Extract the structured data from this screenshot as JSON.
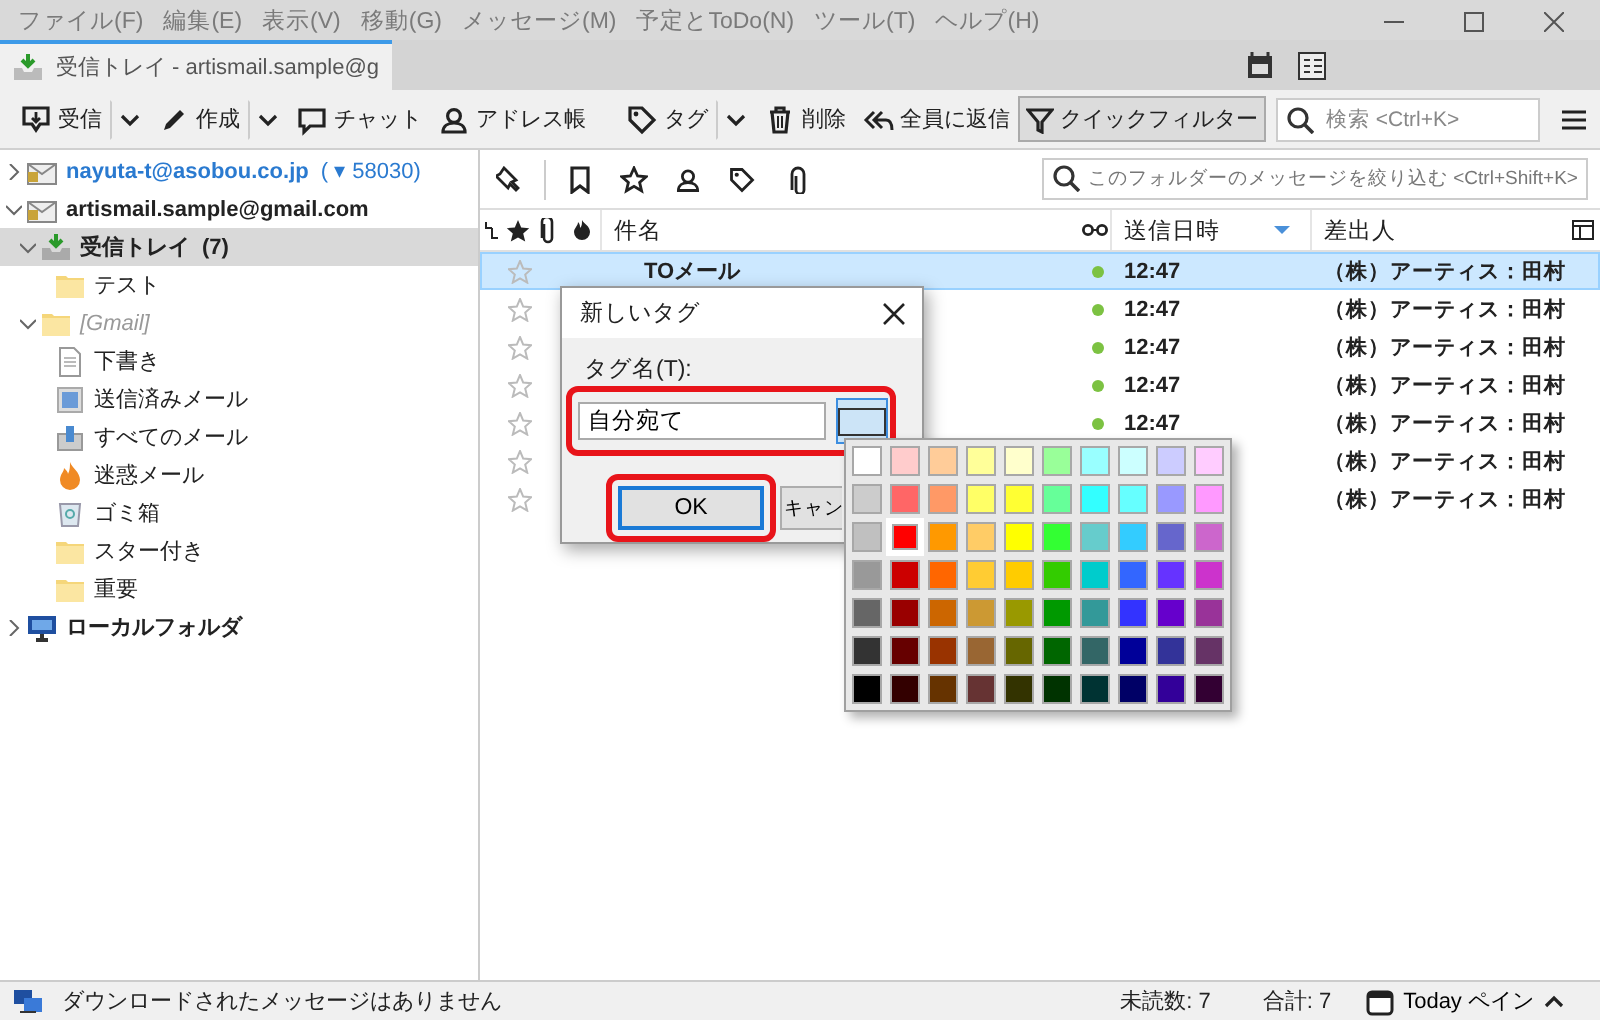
{
  "menu_bar": {
    "items": [
      "ファイル(F)",
      "編集(E)",
      "表示(V)",
      "移動(G)",
      "メッセージ(M)",
      "予定とToDo(N)",
      "ツール(T)",
      "ヘルプ(H)"
    ]
  },
  "tabs": [
    {
      "label": "受信トレイ - artismail.sample@g",
      "selected": true
    }
  ],
  "toolbar": {
    "left": [
      {
        "label": "受信",
        "kind": "get",
        "dropdown": true
      },
      {
        "label": "作成",
        "kind": "write",
        "dropdown": true
      },
      {
        "label": "チャット",
        "kind": "chat",
        "dropdown": false
      },
      {
        "label": "アドレス帳",
        "kind": "contacts",
        "dropdown": false
      },
      {
        "label": "タグ",
        "kind": "tag",
        "dropdown": true
      },
      {
        "label": "削除",
        "kind": "delete",
        "dropdown": false
      }
    ],
    "reply_all": {
      "label": "全員に返信"
    },
    "quick_filter": {
      "label": "クイックフィルター",
      "on": true
    },
    "search": {
      "placeholder": "検索 <Ctrl+K>"
    }
  },
  "folders": [
    {
      "label": "nayuta-t@asobou.co.jp",
      "count": "( ▾ 58030)",
      "kind": "account",
      "expanded": false,
      "selected": false
    },
    {
      "label": "artismail.sample@gmail.com",
      "kind": "account",
      "expanded": true,
      "selected": false,
      "children": [
        {
          "label": "受信トレイ",
          "count": "(7)",
          "kind": "inbox",
          "expanded": true,
          "selected": true,
          "children": [
            {
              "label": "テスト",
              "kind": "folder",
              "selected": false
            }
          ]
        },
        {
          "label": "[Gmail]",
          "kind": "folder",
          "expanded": true,
          "selected": false,
          "children": [
            {
              "label": "下書き",
              "kind": "drafts",
              "selected": false
            },
            {
              "label": "送信済みメール",
              "kind": "sent",
              "selected": false
            },
            {
              "label": "すべてのメール",
              "kind": "archive",
              "selected": false
            },
            {
              "label": "迷惑メール",
              "kind": "junk",
              "selected": false
            },
            {
              "label": "ゴミ箱",
              "kind": "trash",
              "selected": false
            },
            {
              "label": "スター付き",
              "kind": "folder",
              "selected": false
            },
            {
              "label": "重要",
              "kind": "folder",
              "selected": false
            }
          ]
        }
      ]
    },
    {
      "label": "ローカルフォルダ",
      "kind": "local",
      "expanded": false,
      "selected": false
    }
  ],
  "filter_bar": {
    "placeholder": "このフォルダーのメッセージを絞り込む <Ctrl+Shift+K>"
  },
  "columns": [
    {
      "label": "件名"
    },
    {
      "label": "送信日時",
      "sorted": true
    },
    {
      "label": "差出人"
    }
  ],
  "messages": [
    {
      "subject": "TOメール",
      "date": "12:47",
      "sender": "（株）アーティス：田村",
      "selected": true,
      "starred": false,
      "unread": true
    },
    {
      "date": "12:47",
      "sender": "（株）アーティス：田村",
      "selected": false,
      "starred": false,
      "unread": true
    },
    {
      "date": "12:47",
      "sender": "（株）アーティス：田村",
      "selected": false,
      "starred": false,
      "unread": true
    },
    {
      "date": "12:47",
      "sender": "（株）アーティス：田村",
      "selected": false,
      "starred": false,
      "unread": true
    },
    {
      "date": "12:47",
      "sender": "（株）アーティス：田村",
      "selected": false,
      "starred": false,
      "unread": true
    },
    {
      "sender": "（株）アーティス：田村",
      "selected": false,
      "starred": false,
      "unread": true
    },
    {
      "sender": "（株）アーティス：田村",
      "selected": false,
      "starred": false,
      "unread": true
    }
  ],
  "new_tag_dialog": {
    "title": "新しいタグ",
    "field_label": "タグ名(T):",
    "value": "自分宛て",
    "ok": "OK",
    "cancel": "キャン",
    "color_palette": {
      "rows": [
        {
          "swatches": [
            {
              "color": "#ffffff",
              "selected": false
            },
            {
              "color": "#ffcccc",
              "selected": false
            },
            {
              "color": "#ffcc99",
              "selected": false
            },
            {
              "color": "#ffff99",
              "selected": false
            },
            {
              "color": "#ffffcc",
              "selected": false
            },
            {
              "color": "#99ff99",
              "selected": false
            },
            {
              "color": "#99ffff",
              "selected": false
            },
            {
              "color": "#ccffff",
              "selected": false
            },
            {
              "color": "#ccccff",
              "selected": false
            },
            {
              "color": "#ffccff",
              "selected": false
            }
          ]
        },
        {
          "swatches": [
            {
              "color": "#cccccc",
              "selected": false
            },
            {
              "color": "#ff6666",
              "selected": false
            },
            {
              "color": "#ff9966",
              "selected": false
            },
            {
              "color": "#ffff66",
              "selected": false
            },
            {
              "color": "#ffff33",
              "selected": false
            },
            {
              "color": "#66ff99",
              "selected": false
            },
            {
              "color": "#33ffff",
              "selected": false
            },
            {
              "color": "#66ffff",
              "selected": false
            },
            {
              "color": "#9999ff",
              "selected": false
            },
            {
              "color": "#ff99ff",
              "selected": false
            }
          ]
        },
        {
          "swatches": [
            {
              "color": "#c0c0c0",
              "selected": false
            },
            {
              "color": "#ff0000",
              "selected": true
            },
            {
              "color": "#ff9900",
              "selected": false
            },
            {
              "color": "#ffcc66",
              "selected": false
            },
            {
              "color": "#ffff00",
              "selected": false
            },
            {
              "color": "#33ff33",
              "selected": false
            },
            {
              "color": "#66cccc",
              "selected": false
            },
            {
              "color": "#33ccff",
              "selected": false
            },
            {
              "color": "#6666cc",
              "selected": false
            },
            {
              "color": "#cc66cc",
              "selected": false
            }
          ]
        },
        {
          "swatches": [
            {
              "color": "#999999",
              "selected": false
            },
            {
              "color": "#cc0000",
              "selected": false
            },
            {
              "color": "#ff6600",
              "selected": false
            },
            {
              "color": "#ffcc33",
              "selected": false
            },
            {
              "color": "#ffcc00",
              "selected": false
            },
            {
              "color": "#33cc00",
              "selected": false
            },
            {
              "color": "#00cccc",
              "selected": false
            },
            {
              "color": "#3366ff",
              "selected": false
            },
            {
              "color": "#6633ff",
              "selected": false
            },
            {
              "color": "#cc33cc",
              "selected": false
            }
          ]
        },
        {
          "swatches": [
            {
              "color": "#666666",
              "selected": false
            },
            {
              "color": "#990000",
              "selected": false
            },
            {
              "color": "#cc6600",
              "selected": false
            },
            {
              "color": "#cc9933",
              "selected": false
            },
            {
              "color": "#999900",
              "selected": false
            },
            {
              "color": "#009900",
              "selected": false
            },
            {
              "color": "#339999",
              "selected": false
            },
            {
              "color": "#3333ff",
              "selected": false
            },
            {
              "color": "#6600cc",
              "selected": false
            },
            {
              "color": "#993399",
              "selected": false
            }
          ]
        },
        {
          "swatches": [
            {
              "color": "#333333",
              "selected": false
            },
            {
              "color": "#660000",
              "selected": false
            },
            {
              "color": "#993300",
              "selected": false
            },
            {
              "color": "#996633",
              "selected": false
            },
            {
              "color": "#666600",
              "selected": false
            },
            {
              "color": "#006600",
              "selected": false
            },
            {
              "color": "#336666",
              "selected": false
            },
            {
              "color": "#000099",
              "selected": false
            },
            {
              "color": "#333399",
              "selected": false
            },
            {
              "color": "#663366",
              "selected": false
            }
          ]
        },
        {
          "swatches": [
            {
              "color": "#000000",
              "selected": false
            },
            {
              "color": "#330000",
              "selected": false
            },
            {
              "color": "#663300",
              "selected": false
            },
            {
              "color": "#663333",
              "selected": false
            },
            {
              "color": "#333300",
              "selected": false
            },
            {
              "color": "#003300",
              "selected": false
            },
            {
              "color": "#003333",
              "selected": false
            },
            {
              "color": "#000066",
              "selected": false
            },
            {
              "color": "#330099",
              "selected": false
            },
            {
              "color": "#330033",
              "selected": false
            }
          ]
        }
      ]
    }
  },
  "status_bar": {
    "message": "ダウンロードされたメッセージはありません",
    "unread": "未読数: 7",
    "total": "合計: 7",
    "today_pane": "Today ペイン"
  }
}
